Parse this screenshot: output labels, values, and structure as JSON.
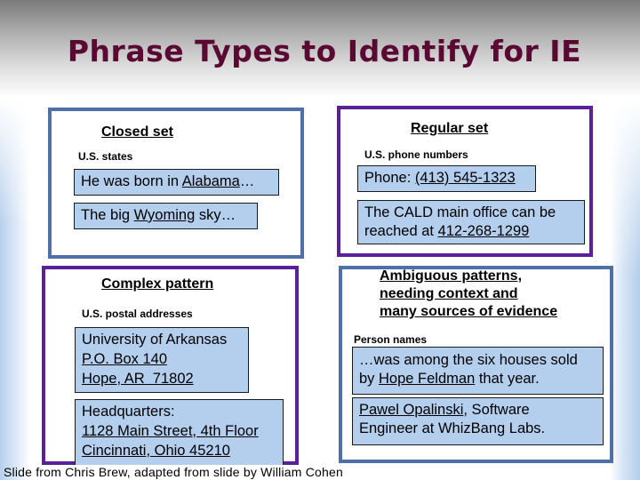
{
  "slide": {
    "title": "Phrase Types to Identify for IE",
    "credit": "Slide from Chris Brew, adapted from slide by William Cohen"
  },
  "colors": {
    "title": "#5a0a32",
    "blue_border": "#4e6fa8",
    "purple_border": "#5b1f9c",
    "example_fill": "#b4cfee"
  },
  "panels": {
    "closed_set": {
      "heading": "Closed set",
      "sublabel": "U.S. states",
      "examples": [
        {
          "before": "He was born in ",
          "entity": "Alabama",
          "after": "…"
        },
        {
          "before": "The big ",
          "entity": "Wyoming",
          "after": " sky…"
        }
      ]
    },
    "regular_set": {
      "heading": "Regular set",
      "sublabel": "U.S. phone numbers",
      "examples": [
        {
          "before": "Phone: ",
          "entity": "(413) 545-1323",
          "after": ""
        },
        {
          "line1": "The CALD main office can be",
          "before": "reached at ",
          "entity": "412-268-1299",
          "after": ""
        }
      ]
    },
    "complex_pattern": {
      "heading": "Complex pattern",
      "sublabel": "U.S. postal addresses",
      "examples": [
        {
          "line1": "University of Arkansas",
          "line2": "P.O. Box 140",
          "line3": "Hope, AR  71802"
        },
        {
          "line1": "Headquarters:",
          "line2": "1128 Main Street, 4th Floor",
          "line3": "Cincinnati, Ohio 45210"
        }
      ]
    },
    "ambiguous": {
      "heading_lines": [
        "Ambiguous patterns,",
        "needing context and",
        "many sources of evidence"
      ],
      "sublabel": "Person names",
      "examples": [
        {
          "line1": "…was among the six houses sold",
          "before": "by ",
          "entity": "Hope Feldman",
          "after": " that year."
        },
        {
          "entity": "Pawel Opalinski",
          "after": ", Software",
          "line2": "Engineer at WhizBang Labs."
        }
      ]
    }
  }
}
